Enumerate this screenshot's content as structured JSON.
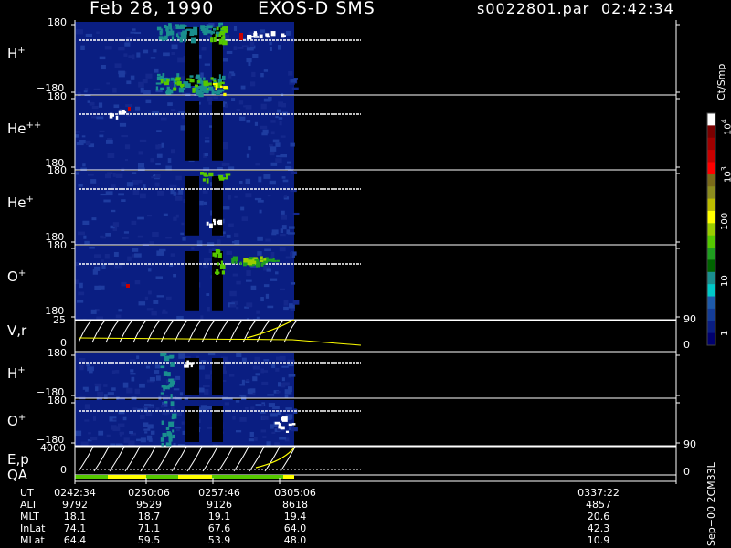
{
  "header": {
    "date": "Feb 28, 1990",
    "instrument": "EXOS-D SMS",
    "filename": "s0022801.par",
    "time": "02:42:34"
  },
  "panels": [
    {
      "id": "h1",
      "label_base": "H",
      "label_sup": "+",
      "ymax": "180",
      "ymin": "−180"
    },
    {
      "id": "he2",
      "label_base": "He",
      "label_sup": "++",
      "ymax": "180",
      "ymin": "−180"
    },
    {
      "id": "he1",
      "label_base": "He",
      "label_sup": "+",
      "ymax": "180",
      "ymin": "−180"
    },
    {
      "id": "o1",
      "label_base": "O",
      "label_sup": "+",
      "ymax": "180",
      "ymin": "−180"
    },
    {
      "id": "vr",
      "label_base": "V,r",
      "label_sup": "",
      "ymax": "25",
      "ymin": "0",
      "rmax": "90",
      "rmin": "0"
    },
    {
      "id": "h2",
      "label_base": "H",
      "label_sup": "+",
      "ymax": "180",
      "ymin": "−180"
    },
    {
      "id": "o2",
      "label_base": "O",
      "label_sup": "+",
      "ymax": "180",
      "ymin": "−180"
    },
    {
      "id": "ep",
      "label_base": "E,p",
      "label_sup": "",
      "ymax": "4000",
      "ymin": "0",
      "rmax": "90",
      "rmin": "0"
    }
  ],
  "qa_label": "QA",
  "colorbar": {
    "unit": "Ct/Smp",
    "ticks": [
      {
        "base": "10",
        "exp": "4"
      },
      {
        "base": "10",
        "exp": "3"
      },
      {
        "base": "100",
        "exp": ""
      },
      {
        "base": "10",
        "exp": ""
      },
      {
        "base": "1",
        "exp": ""
      }
    ],
    "colors": [
      "#ffffff",
      "#7a0000",
      "#a00000",
      "#c80000",
      "#ff0000",
      "#7a6a1a",
      "#8c8c1e",
      "#bcbc00",
      "#ffff00",
      "#9acd00",
      "#55c800",
      "#1f9e1f",
      "#006400",
      "#1a8f8f",
      "#00c8c8",
      "#1e5aaa",
      "#143c96",
      "#0a1e82",
      "#00006e"
    ]
  },
  "footer": {
    "row_labels": [
      "UT",
      "ALT",
      "MLT",
      "InLat",
      "MLat"
    ],
    "columns": [
      {
        "ut": "0242:34",
        "alt": "9792",
        "mlt": "18.1",
        "inlat": "74.1",
        "mlat": "64.4"
      },
      {
        "ut": "0250:06",
        "alt": "9529",
        "mlt": "18.7",
        "inlat": "71.1",
        "mlat": "59.5"
      },
      {
        "ut": "0257:46",
        "alt": "9126",
        "mlt": "19.1",
        "inlat": "67.6",
        "mlat": "53.9"
      },
      {
        "ut": "0305:06",
        "alt": "8618",
        "mlt": "19.4",
        "inlat": "64.0",
        "mlat": "48.0"
      },
      {
        "ut": "0337:22",
        "alt": "4857",
        "mlt": "20.6",
        "inlat": "42.3",
        "mlat": "10.9"
      }
    ],
    "version": "Sep−00 2CM33L"
  },
  "chart_data": {
    "type": "heatmap",
    "title": "Feb 28, 1990   EXOS-D SMS",
    "x_ticks_ut": [
      "0242:34",
      "0250:06",
      "0257:46",
      "0305:06",
      "0337:22"
    ],
    "panels": [
      "H+",
      "He++",
      "He+",
      "O+",
      "V,r",
      "H+",
      "O+",
      "E,p",
      "QA"
    ],
    "pitch_angle_range": [
      -180,
      180
    ],
    "velocity_range": [
      0,
      25
    ],
    "energy_range": [
      0,
      4000
    ],
    "colorscale": "log counts per sample, 1 to 10^4"
  }
}
